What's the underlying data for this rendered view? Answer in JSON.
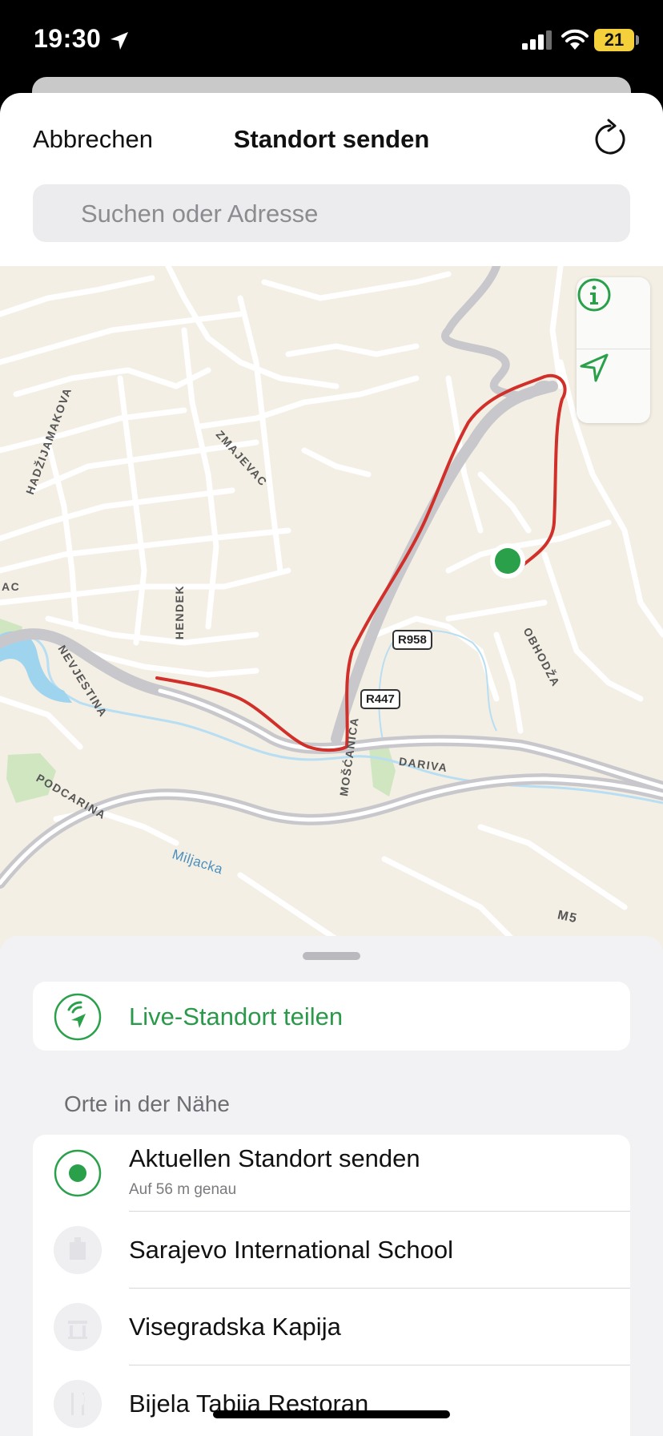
{
  "status_bar": {
    "time": "19:30",
    "battery": "21",
    "icons": [
      "location-arrow-icon",
      "signal-icon",
      "wifi-icon",
      "battery-icon"
    ]
  },
  "nav": {
    "cancel": "Abbrechen",
    "title": "Standort senden",
    "refresh_icon": "refresh-icon"
  },
  "search": {
    "placeholder": "Suchen oder Adresse"
  },
  "map": {
    "street_labels": [
      "HADŽIJAMAKOVA",
      "ZMAJEVAC",
      "AC",
      "HENDEK",
      "NEVJESTINA",
      "MOŠĆANICA",
      "DARIVA",
      "OBHODŽA",
      "PODCARINA",
      "M5"
    ],
    "water_label": "Miljacka",
    "road_shields": [
      "R958",
      "R447"
    ],
    "controls": [
      "info-icon",
      "location-icon"
    ],
    "colors": {
      "route": "#d1302a",
      "pin": "#2aa04a",
      "water": "#9fd4ef"
    }
  },
  "panel": {
    "live_location": "Live-Standort teilen",
    "section_title": "Orte in der Nähe",
    "places": [
      {
        "title": "Aktuellen Standort senden",
        "subtitle": "Auf 56 m genau",
        "icon": "current-location-icon"
      },
      {
        "title": "Sarajevo International School",
        "icon": "school-icon"
      },
      {
        "title": "Visegradska Kapija",
        "icon": "landmark-icon"
      },
      {
        "title": "Bijela Tabija Restoran",
        "icon": "restaurant-icon"
      }
    ]
  }
}
